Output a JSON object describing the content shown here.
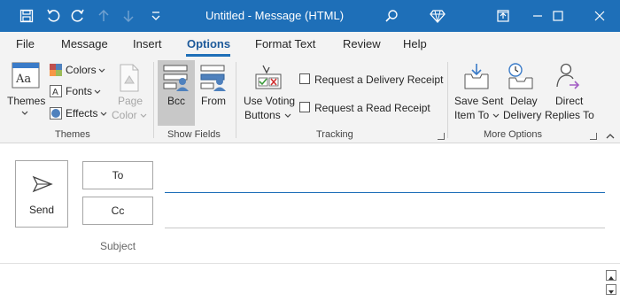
{
  "window": {
    "title": "Untitled  -  Message (HTML)"
  },
  "quick_access": {
    "icons": [
      "save-icon",
      "undo-icon",
      "redo-icon",
      "previous-item-icon",
      "next-item-icon",
      "customize-quick-access-icon"
    ]
  },
  "title_icons": [
    "search-icon",
    "diamond-icon"
  ],
  "window_controls": [
    "ribbon-display-options-icon",
    "minimize-icon",
    "maximize-icon",
    "close-icon"
  ],
  "menu": {
    "tabs": [
      "File",
      "Message",
      "Insert",
      "Options",
      "Format Text",
      "Review",
      "Help"
    ],
    "active": "Options"
  },
  "ribbon": {
    "themes_group": {
      "name": "Themes",
      "themes_label": "Themes",
      "colors_label": "Colors",
      "fonts_label": "Fonts",
      "effects_label": "Effects",
      "page_color_line1": "Page",
      "page_color_line2": "Color"
    },
    "show_fields_group": {
      "name": "Show Fields",
      "bcc_label": "Bcc",
      "from_label": "From"
    },
    "tracking_group": {
      "name": "Tracking",
      "voting_line1": "Use Voting",
      "voting_line2": "Buttons",
      "delivery_receipt": "Request a Delivery Receipt",
      "read_receipt": "Request a Read Receipt"
    },
    "more_options_group": {
      "name": "More Options",
      "save_sent_line1": "Save Sent",
      "save_sent_line2": "Item To",
      "delay_line1": "Delay",
      "delay_line2": "Delivery",
      "direct_line1": "Direct",
      "direct_line2": "Replies To"
    }
  },
  "compose": {
    "send_label": "Send",
    "to_label": "To",
    "cc_label": "Cc",
    "subject_label": "Subject"
  },
  "colors": {
    "title_bar": "#1e6fb8",
    "accent": "#1e5a9a",
    "ribbon_bg": "#f3f3f3"
  }
}
